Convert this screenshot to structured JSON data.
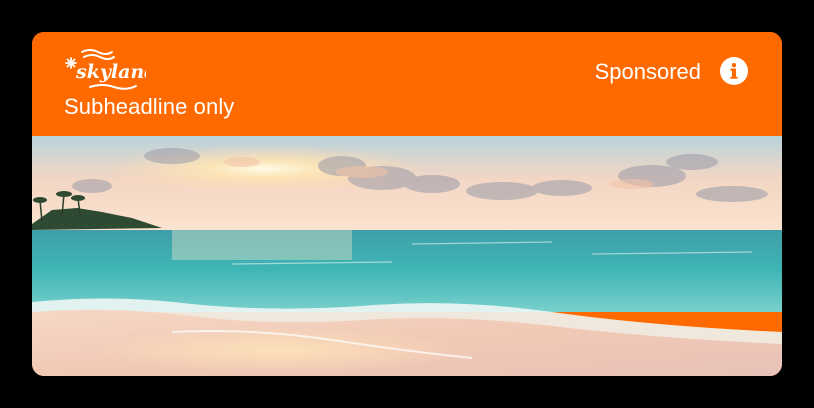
{
  "ad": {
    "brand_name": "skyland",
    "subheadline": "Subheadline only",
    "sponsored_label": "Sponsored",
    "info_icon": "info-icon",
    "hero_image": "beach-sunset-photo"
  },
  "colors": {
    "header_bg": "#ff6a00",
    "text": "#ffffff",
    "page_bg": "#000000"
  }
}
